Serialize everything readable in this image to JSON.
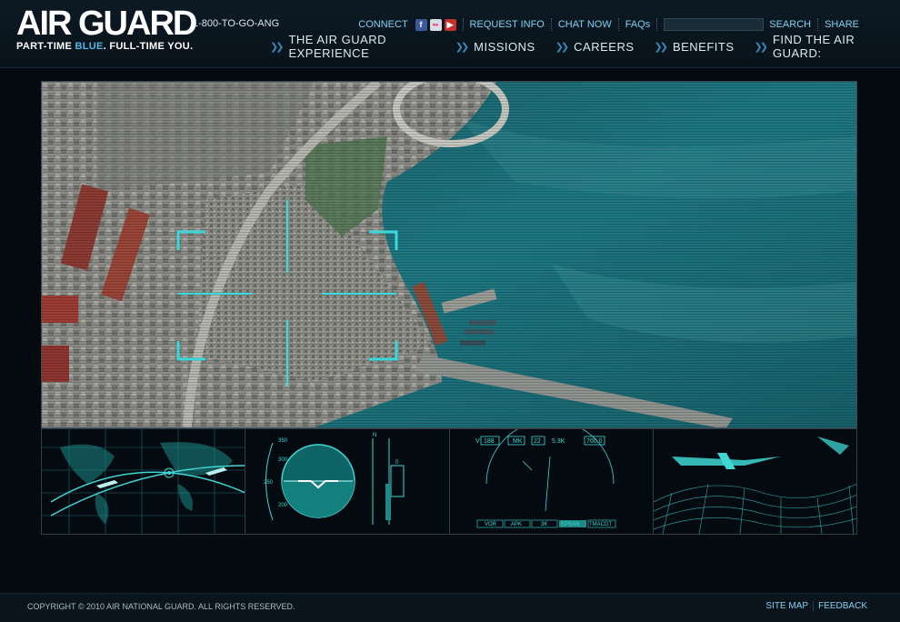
{
  "brand": {
    "logo": "AIR GUARD",
    "tagline_part1": "PART-TIME ",
    "tagline_blue": "BLUE",
    "tagline_part2": ". FULL-TIME YOU.",
    "phone": "1-800-TO-GO-ANG"
  },
  "util": {
    "connect": "CONNECT",
    "request_info": "REQUEST INFO",
    "chat_now": "CHAT NOW",
    "faqs": "FAQs",
    "search_label": "SEARCH",
    "search_value": "",
    "share": "SHARE",
    "social_icons": [
      "facebook-icon",
      "flickr-icon",
      "youtube-icon"
    ]
  },
  "nav": {
    "items": [
      "THE AIR GUARD EXPERIENCE",
      "MISSIONS",
      "CAREERS",
      "BENEFITS",
      "FIND THE AIR GUARD:"
    ]
  },
  "hud": {
    "readout_v": "V",
    "readout_1": "188",
    "readout_2": "MK",
    "readout_3": "22",
    "readout_4": "5.3K",
    "readout_5": "760.0",
    "buttons": [
      "VOR",
      "APK",
      "3K",
      "EPSAN",
      "TMACDT"
    ]
  },
  "footer": {
    "copyright": "COPYRIGHT © 2010 AIR NATIONAL GUARD. ALL RIGHTS RESERVED.",
    "site_map": "SITE MAP",
    "feedback": "FEEDBACK"
  },
  "colors": {
    "accent": "#4ab8e8",
    "hud_cyan": "#3fd7d4",
    "water": "#1d6f78",
    "land": "#9a9a96"
  }
}
